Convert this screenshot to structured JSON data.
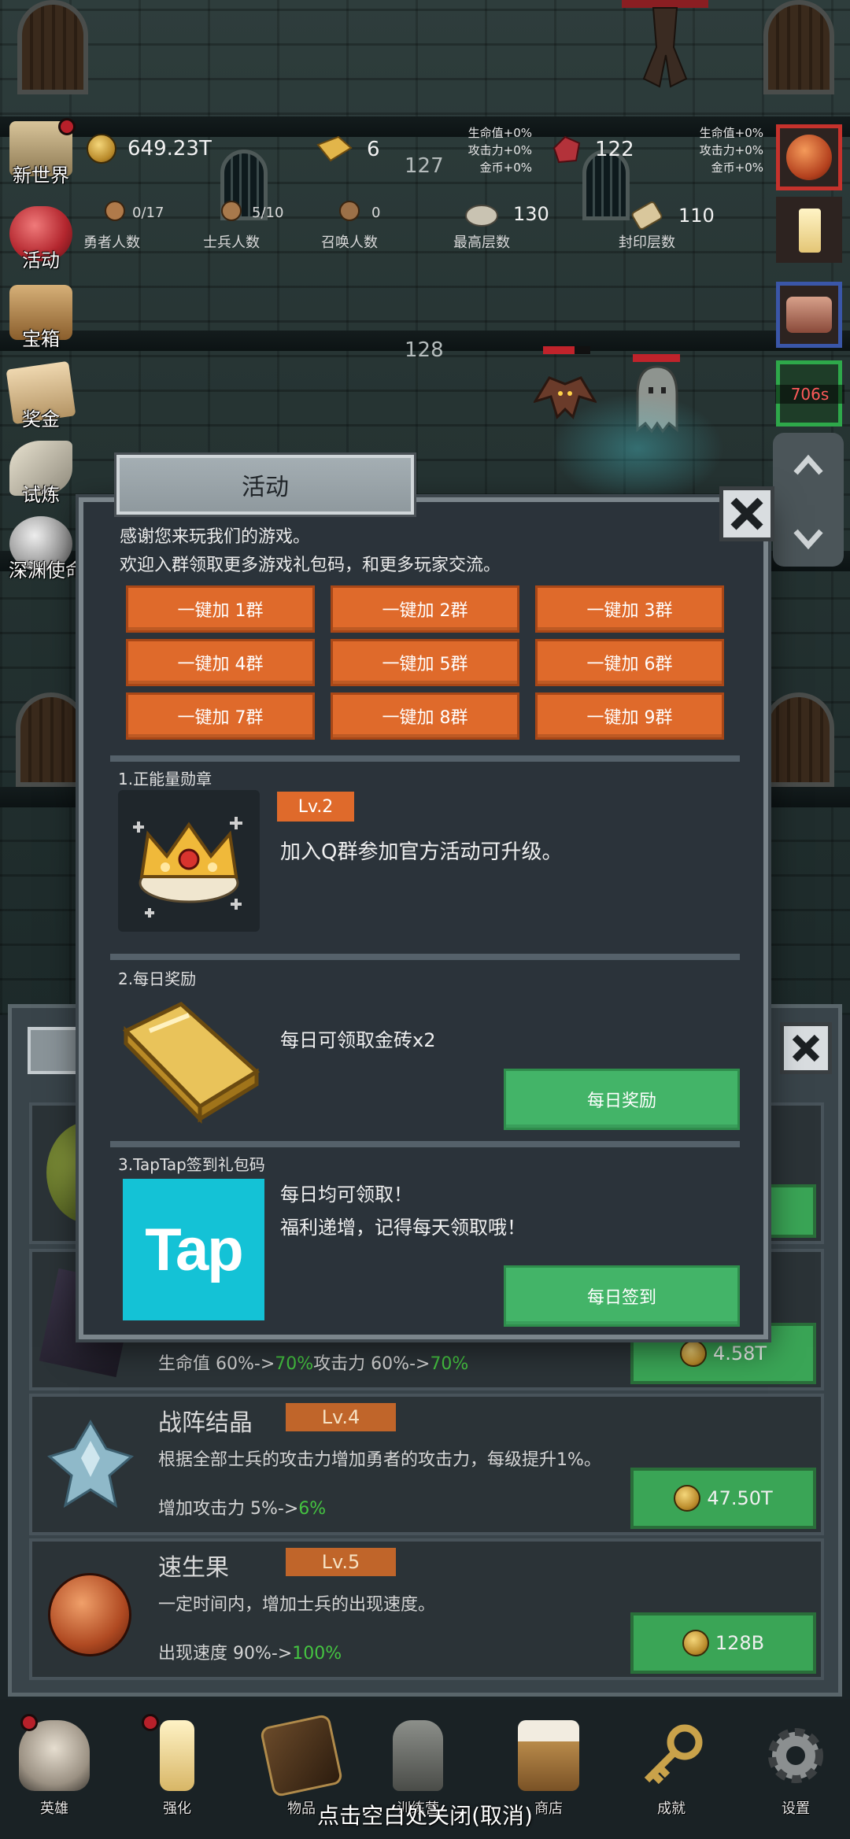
{
  "hud": {
    "gold": "649.23T",
    "gold_bricks": "6",
    "gems": "122",
    "floor_top": "127",
    "floor_mid": "128",
    "buff_left": [
      "生命值+0%",
      "攻击力+0%",
      "金币+0%"
    ],
    "buff_right": [
      "生命值+0%",
      "攻击力+0%",
      "金币+0%"
    ],
    "heroes": {
      "value": "0/17",
      "label": "勇者人数"
    },
    "soldiers": {
      "value": "5/10",
      "label": "士兵人数"
    },
    "summons": {
      "value": "0",
      "label": "召唤人数"
    },
    "max_floor": {
      "value": "130",
      "label": "最高层数"
    },
    "seal_floor": {
      "value": "110",
      "label": "封印层数"
    },
    "boss_timer": "706s"
  },
  "side_menu": [
    {
      "label": "新世界"
    },
    {
      "label": "活动"
    },
    {
      "label": "宝箱"
    },
    {
      "label": "奖金"
    },
    {
      "label": "试炼"
    },
    {
      "label": "深渊使命"
    }
  ],
  "modal": {
    "title": "活动",
    "intro_line1": "感谢您来玩我们的游戏。",
    "intro_line2": "欢迎入群领取更多游戏礼包码，和更多玩家交流。",
    "group_buttons": [
      "一键加 1群",
      "一键加 2群",
      "一键加 3群",
      "一键加 4群",
      "一键加 5群",
      "一键加 6群",
      "一键加 7群",
      "一键加 8群",
      "一键加 9群"
    ],
    "section1": {
      "title": "1.正能量勋章",
      "level": "Lv.2",
      "text": "加入Q群参加官方活动可升级。"
    },
    "section2": {
      "title": "2.每日奖励",
      "text": "每日可领取金砖x2",
      "button": "每日奖励"
    },
    "section3": {
      "title": "3.TapTap签到礼包码",
      "logo_text": "Tap",
      "text_line1": "每日均可领取！",
      "text_line2": "福利递增，记得每天领取哦！",
      "button": "每日签到"
    }
  },
  "upgrades": {
    "partial_stat": "生命值 60%->70%攻击力 60%->70%",
    "partial_stat_base1": "生命值 60%->",
    "partial_stat_up1": "70%",
    "partial_stat_base2": "攻击力 60%->",
    "partial_stat_up2": "70%",
    "partial_price": "4.58T",
    "items": [
      {
        "name": "战阵结晶",
        "level": "Lv.4",
        "desc": "根据全部士兵的攻击力增加勇者的攻击力，每级提升1%。",
        "stat_base": "增加攻击力 5%->",
        "stat_up": "6%",
        "price": "47.50T"
      },
      {
        "name": "速生果",
        "level": "Lv.5",
        "desc": "一定时间内，增加士兵的出现速度。",
        "stat_base": "出现速度 90%->",
        "stat_up": "100%",
        "price": "128B"
      }
    ]
  },
  "bottom_nav": [
    {
      "label": "英雄"
    },
    {
      "label": "强化"
    },
    {
      "label": "物品"
    },
    {
      "label": "训练营"
    },
    {
      "label": "商店"
    },
    {
      "label": "成就"
    },
    {
      "label": "设置"
    }
  ],
  "close_hint": "点击空白处关闭(取消)",
  "colors": {
    "orange_button": "#df6a2b",
    "green_button": "#43b468",
    "level_badge": "#c0652a",
    "upgrade_green_text": "#45c441",
    "tap_logo_bg": "#14c2d6"
  }
}
